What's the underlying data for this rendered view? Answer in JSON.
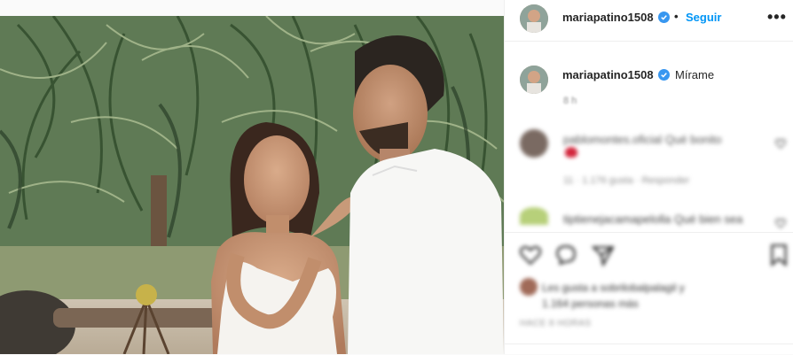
{
  "header": {
    "username": "mariapatino1508",
    "separator": "•",
    "follow_label": "Seguir",
    "more_label": "•••"
  },
  "caption": {
    "username": "mariapatino1508",
    "text": "Mírame",
    "time": "8 h"
  },
  "comments": [
    {
      "text": "pablomontes.oficial  Qué bonito",
      "meta": "11 · 1.176 gusta · Responder"
    },
    {
      "text": "tiptienejacamapelolla Qué bien sea"
    }
  ],
  "likes": {
    "line1": "Les gusta a sobrilobalpalagil y",
    "line2": "1.164 personas más"
  },
  "date": "HACE 8 HORAS",
  "icons": {
    "verified": "verified-badge-icon",
    "heart": "heart-icon",
    "comment": "comment-icon",
    "share": "share-icon",
    "save": "bookmark-icon",
    "more": "ellipsis-icon"
  },
  "colors": {
    "accent": "#0095f6",
    "verified": "#3897f0",
    "text": "#262626",
    "muted": "#8e8e8e"
  }
}
